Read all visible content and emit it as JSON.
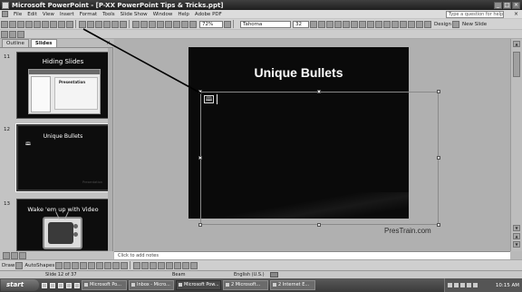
{
  "window": {
    "title": "Microsoft PowerPoint - [P-XX PowerPoint Tips & Tricks.ppt]",
    "buttons": {
      "minimize": "_",
      "maximize": "□",
      "close": "×"
    }
  },
  "menubar": {
    "items": [
      "File",
      "Edit",
      "View",
      "Insert",
      "Format",
      "Tools",
      "Slide Show",
      "Window",
      "Help",
      "Adobe PDF"
    ],
    "help_placeholder": "Type a question for help",
    "close_glyph": "×"
  },
  "toolbar": {
    "zoom": "72%",
    "font": "Tahoma",
    "font_size": "32",
    "new_slide_label": "New Slide",
    "design_label": "Design"
  },
  "left_panel": {
    "tabs": [
      "Outline",
      "Slides"
    ],
    "active_tab": "Slides",
    "close_glyph": "×",
    "slides": [
      {
        "number": "11",
        "title": "Hiding Slides",
        "inner_label": "Presentation"
      },
      {
        "number": "12",
        "title": "Unique Bullets",
        "watermark": "Presentation"
      },
      {
        "number": "13",
        "title": "Wake 'em up with Video"
      }
    ]
  },
  "slide": {
    "title": "Unique Bullets",
    "bullet_glyph": "🕮",
    "watermark": "PresTrain.com"
  },
  "notes": {
    "placeholder": "Click to add notes"
  },
  "drawing_toolbar": {
    "draw_label": "Draw",
    "autoshapes_label": "AutoShapes"
  },
  "status": {
    "slide": "Slide 12 of 37",
    "design": "Beam",
    "language": "English (U.S.)"
  },
  "taskbar": {
    "start_label": "start",
    "tasks": [
      "Microsoft Po...",
      "Inbox - Micro...",
      "Microsoft Pow...",
      "2 Microsoft...",
      "2 Internet E..."
    ],
    "active_task_index": 2,
    "clock": "10:15 AM"
  },
  "colors": {
    "slide_background": "#0a0a0a",
    "pointer_line": "#000000"
  }
}
